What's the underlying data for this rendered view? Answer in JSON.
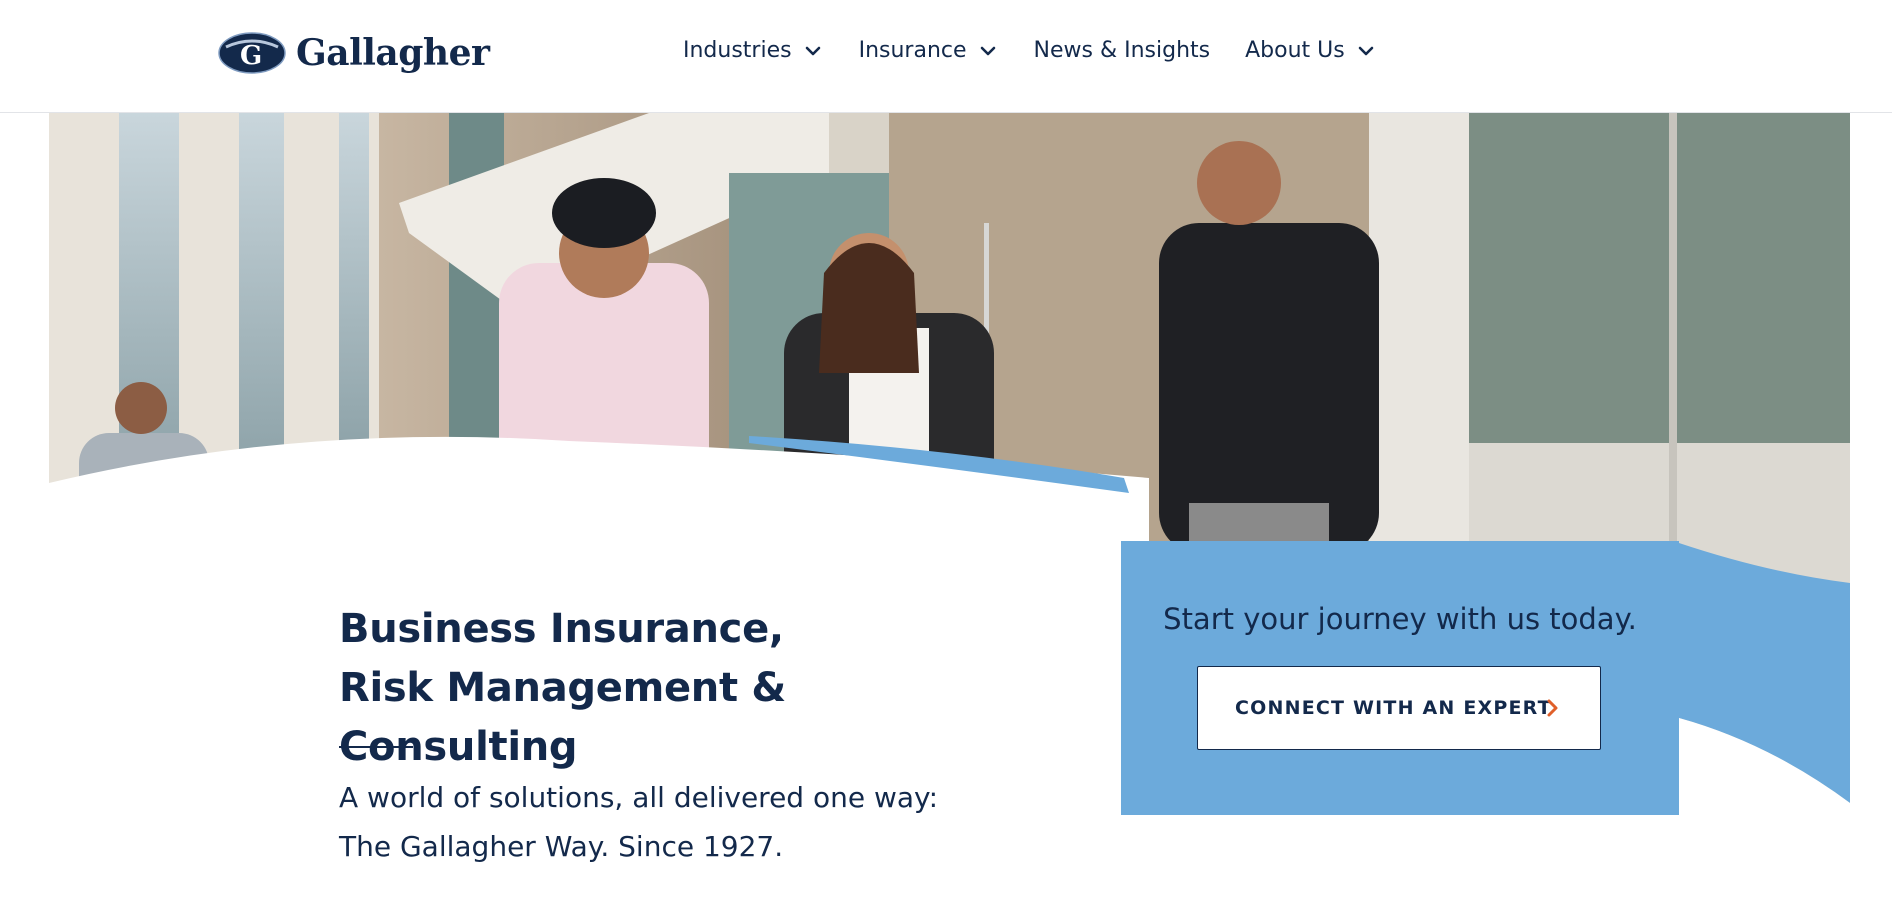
{
  "brand": {
    "name": "Gallagher"
  },
  "nav": {
    "items": [
      {
        "label": "Industries",
        "has_dropdown": true
      },
      {
        "label": "Insurance",
        "has_dropdown": true
      },
      {
        "label": "News & Insights",
        "has_dropdown": false
      },
      {
        "label": "About Us",
        "has_dropdown": true
      }
    ]
  },
  "hero": {
    "title": "Business Insurance, Risk Management & Consulting",
    "subtitle": "A world of solutions, all delivered one way: The Gallagher Way. Since 1927."
  },
  "cta": {
    "prompt": "Start your journey with us today.",
    "button_label": "CONNECT WITH AN EXPERT",
    "button_icon": "chevron-right-icon"
  },
  "colors": {
    "navy": "#13294b",
    "accent_blue": "#6caadb",
    "chevron_orange": "#e0602a"
  }
}
